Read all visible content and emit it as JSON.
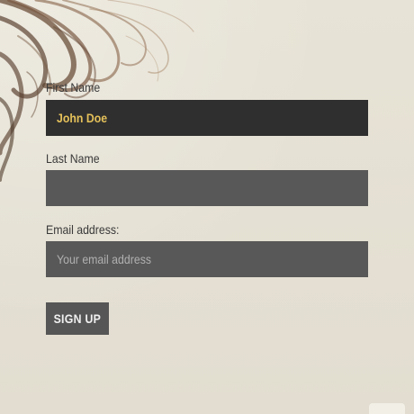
{
  "form": {
    "first_name_label": "First Name",
    "first_name_value": "John Doe",
    "last_name_label": "Last Name",
    "last_name_value": "",
    "email_label": "Email address:",
    "email_placeholder": "Your email address",
    "submit_label": "SIGN UP"
  },
  "colors": {
    "background": "#e4e0d2",
    "field_dark": "#2f2f2f",
    "field_mid": "#585858",
    "value_text": "#e5c15a",
    "button": "#565656"
  }
}
